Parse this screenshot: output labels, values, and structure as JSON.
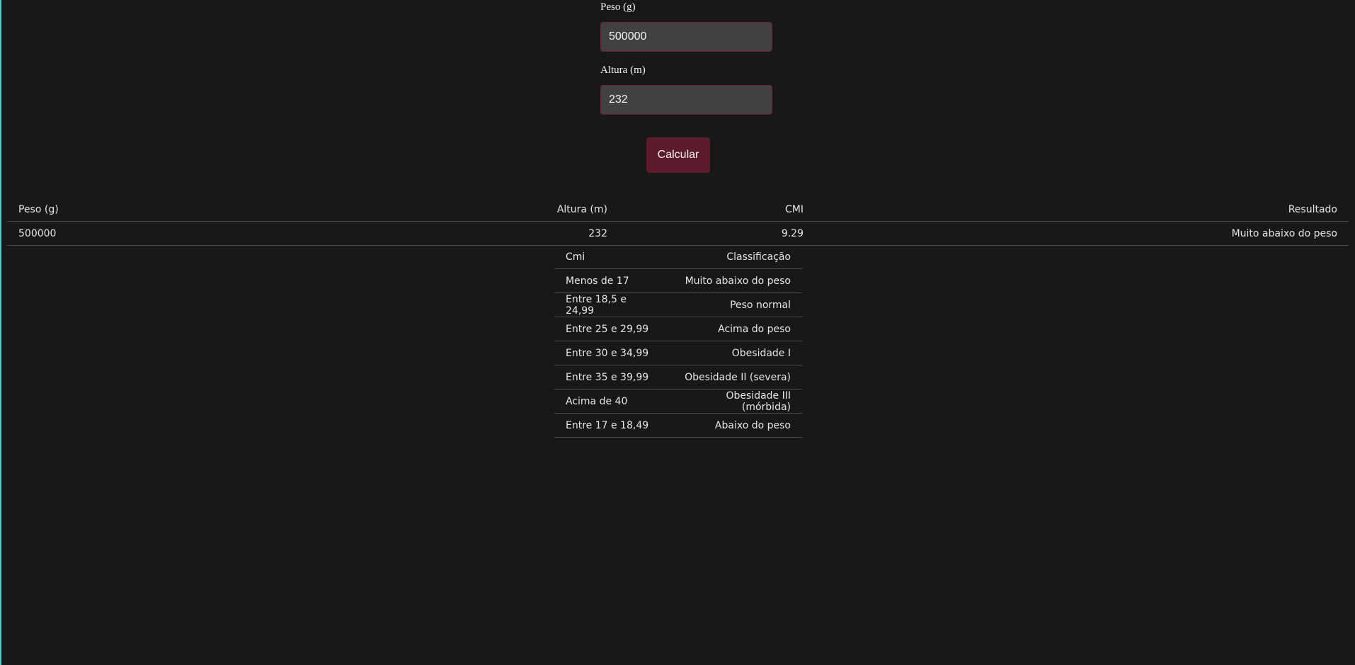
{
  "colors": {
    "background": "#181818",
    "accent_left": "#3fd1c7",
    "button": "#5d1c2c",
    "input_bg": "#414141",
    "input_border": "#6d2231"
  },
  "form": {
    "peso_label": "Peso (g)",
    "peso_value": "500000",
    "altura_label": "Altura (m)",
    "altura_value": "232",
    "calc_button": "Calcular"
  },
  "results_table": {
    "headers": [
      "Peso (g)",
      "Altura (m)",
      "CMI",
      "Resultado"
    ],
    "rows": [
      [
        "500000",
        "232",
        "9.29",
        "Muito abaixo do peso"
      ]
    ]
  },
  "classification_table": {
    "headers": [
      "Cmi",
      "Classificação"
    ],
    "rows": [
      [
        "Menos de 17",
        "Muito abaixo do peso"
      ],
      [
        "Entre 18,5 e 24,99",
        "Peso normal"
      ],
      [
        "Entre 25 e 29,99",
        "Acima do peso"
      ],
      [
        "Entre 30 e 34,99",
        "Obesidade I"
      ],
      [
        "Entre 35 e 39,99",
        "Obesidade II (severa)"
      ],
      [
        "Acima de 40",
        "Obesidade III (mórbida)"
      ],
      [
        "Entre 17 e 18,49",
        "Abaixo do peso"
      ]
    ]
  }
}
